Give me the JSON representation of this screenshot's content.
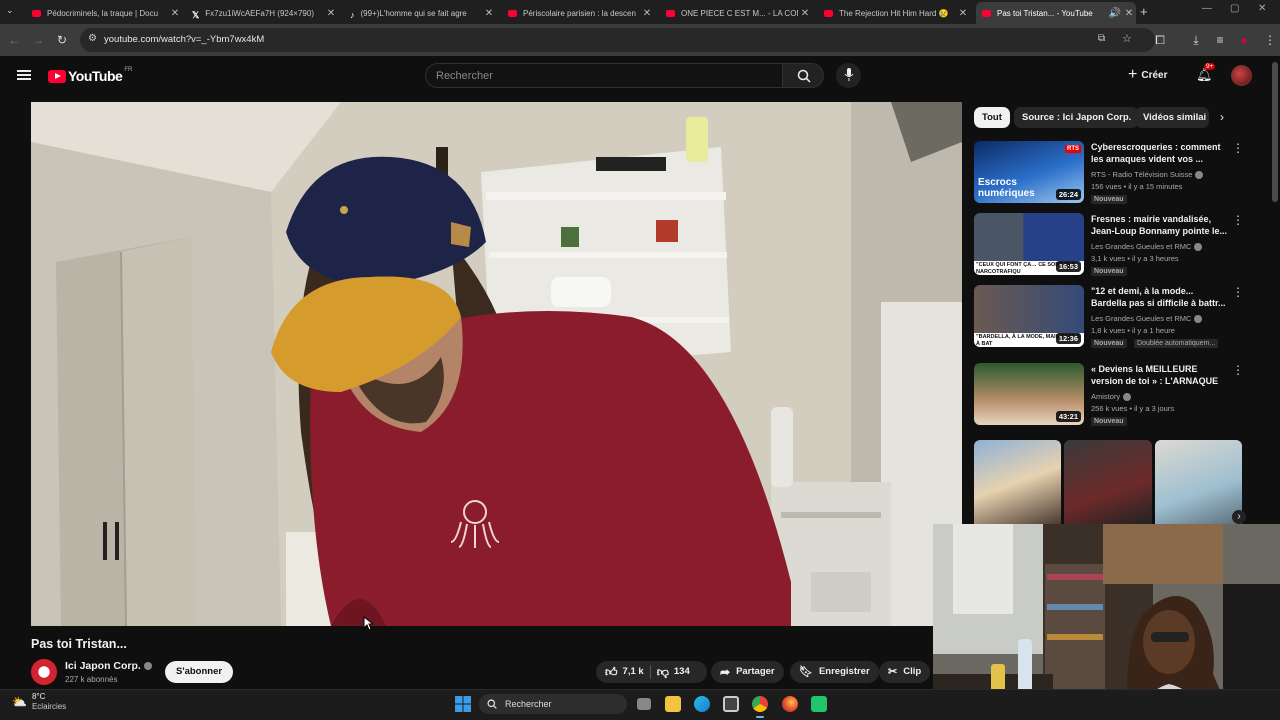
{
  "browser": {
    "tabs": [
      {
        "title": "Pédocriminels, la traque | Docu",
        "icon": "youtube-icon"
      },
      {
        "title": "Fx7zu1iWcAEFa7H (924×790)",
        "icon": "x-icon"
      },
      {
        "title": "(99+)L'homme qui se fait agre",
        "icon": "tiktok-icon"
      },
      {
        "title": "Périscolaire parisien : la descen",
        "icon": "youtube-icon"
      },
      {
        "title": "ONE PIECE C EST M... - LA COM",
        "icon": "youtube-icon"
      },
      {
        "title": "The Rejection Hit Him Hard 😢",
        "icon": "youtube-icon"
      },
      {
        "title": "Pas toi Tristan... - YouTube",
        "icon": "youtube-icon",
        "active": true
      }
    ],
    "url": "youtube.com/watch?v=_-Ybm7wx4kM"
  },
  "youtube": {
    "logo": "YouTube",
    "region": "FR",
    "search_placeholder": "Rechercher",
    "create_label": "Créer",
    "notif_count": "9+"
  },
  "chips": [
    "Tout",
    "Source : Ici Japon Corp.",
    "Vidéos similai"
  ],
  "recommendations": [
    {
      "title": "Cyberescroqueries : comment les arnaques vident vos ...",
      "channel": "RTS - Radio Télévision Suisse",
      "meta": "156 vues • il y a 15 minutes",
      "badge": "Nouveau",
      "duration": "26:24",
      "thumb_text": "Escrocs numériques"
    },
    {
      "title": "Fresnes : mairie vandalisée, Jean-Loup Bonnamy pointe le...",
      "channel": "Les Grandes Gueules et RMC",
      "meta": "3,1 k vues • il y a 3 heures",
      "badge": "Nouveau",
      "duration": "16:53",
      "thumb_text": "\"CEUX QUI FONT ÇA… CE SONT DES NARCOTRAFIQU"
    },
    {
      "title": "\"12 et demi, à la mode... Bardella pas si difficile à battr...",
      "channel": "Les Grandes Gueules et RMC",
      "meta": "1,8 k vues • il y a 1 heure",
      "badge": "Nouveau",
      "badge2": "Doublée automatiquem...",
      "duration": "12:36",
      "thumb_text": "\"BARDELLA, À LA MODE, MAIS FACILE À BAT"
    },
    {
      "title": "« Deviens la MEILLEURE version de toi » : L'ARNAQUE qui nous ...",
      "channel": "Amistory",
      "meta": "256 k vues • il y a 3 jours",
      "badge": "Nouveau",
      "duration": "43:21"
    }
  ],
  "video": {
    "title": "Pas toi Tristan...",
    "channel": "Ici Japon Corp.",
    "subscribers": "227 k abonnés",
    "subscribe_label": "S'abonner",
    "likes": "7,1 k",
    "dislikes": "134",
    "share_label": "Partager",
    "save_label": "Enregistrer",
    "clip_label": "Clip"
  },
  "taskbar": {
    "weather_temp": "8°C",
    "weather_desc": "Eclaircies",
    "search_label": "Rechercher"
  },
  "colors": {
    "youtube_red": "#ff0033",
    "background": "#0f0f0f",
    "shirt": "#8a1c2c",
    "cap_brim": "#d59b2c"
  }
}
